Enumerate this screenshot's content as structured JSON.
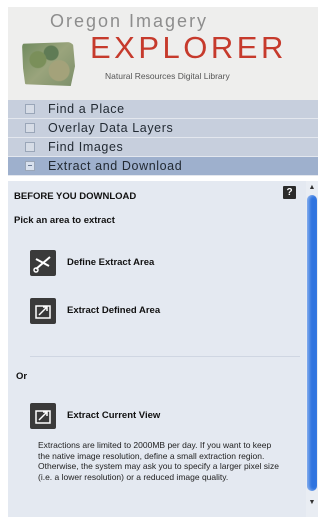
{
  "header": {
    "logo_top": "Oregon Imagery",
    "logo_main": "EXPLORER",
    "logo_sub": "Natural Resources Digital Library"
  },
  "nav": {
    "items": [
      {
        "label": "Find a Place",
        "active": false
      },
      {
        "label": "Overlay Data Layers",
        "active": false
      },
      {
        "label": "Find Images",
        "active": false
      },
      {
        "label": "Extract and Download",
        "active": true
      }
    ]
  },
  "panel": {
    "section_title": "BEFORE YOU DOWNLOAD",
    "help_icon": "?",
    "pick_label": "Pick an area to extract",
    "actions": [
      {
        "label": "Define Extract Area",
        "icon": "scissors-icon"
      },
      {
        "label": "Extract Defined Area",
        "icon": "extract-icon"
      },
      {
        "label": "Extract Current View",
        "icon": "extract-icon"
      }
    ],
    "or_label": "Or",
    "note": "Extractions are limited to 2000MB per day. If you want to keep the native image resolution, define a small extraction region. Otherwise, the system may ask you to specify a larger pixel size (i.e. a lower resolution) or a reduced image quality."
  },
  "colors": {
    "accent_red": "#c63a2c",
    "nav_bg": "#c7cfdd",
    "nav_active_bg": "#9eb0cd",
    "panel_bg": "#e4e9f1",
    "scroll_thumb": "#2f74e0"
  }
}
